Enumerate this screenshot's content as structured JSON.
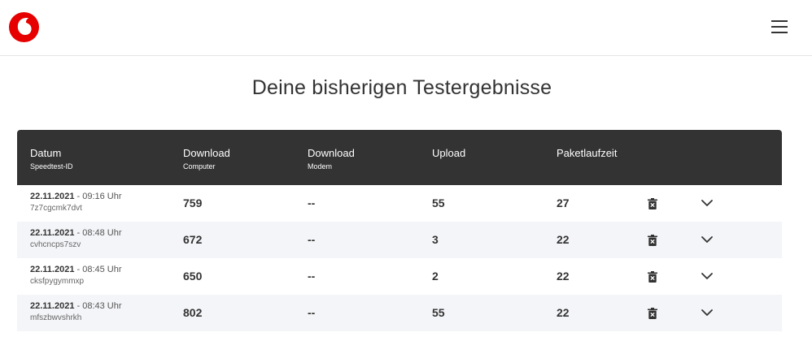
{
  "header": {
    "logo_icon": "vodafone-logo-icon",
    "menu_icon": "hamburger-menu-icon"
  },
  "page": {
    "title": "Deine bisherigen Testergebnisse"
  },
  "table": {
    "columns": [
      {
        "main": "Datum",
        "sub": "Speedtest-ID"
      },
      {
        "main": "Download",
        "sub": "Computer"
      },
      {
        "main": "Download",
        "sub": "Modem"
      },
      {
        "main": "Upload",
        "sub": ""
      },
      {
        "main": "Paketlaufzeit",
        "sub": ""
      }
    ],
    "rows": [
      {
        "date": "22.11.2021",
        "time": " - 09:16 Uhr",
        "id": "7z7cgcmk7dvt",
        "download_computer": "759",
        "download_modem": "--",
        "upload": "55",
        "ping": "27"
      },
      {
        "date": "22.11.2021",
        "time": " - 08:48 Uhr",
        "id": "cvhcncps7szv",
        "download_computer": "672",
        "download_modem": "--",
        "upload": "3",
        "ping": "22"
      },
      {
        "date": "22.11.2021",
        "time": " - 08:45 Uhr",
        "id": "cksfpygymmxp",
        "download_computer": "650",
        "download_modem": "--",
        "upload": "2",
        "ping": "22"
      },
      {
        "date": "22.11.2021",
        "time": " - 08:43 Uhr",
        "id": "mfszbwvshrkh",
        "download_computer": "802",
        "download_modem": "--",
        "upload": "55",
        "ping": "22"
      }
    ],
    "row_actions": {
      "delete_icon": "trash-icon",
      "expand_icon": "chevron-down-icon"
    }
  },
  "colors": {
    "brand_red": "#e60000",
    "header_bg": "#333333",
    "row_alt_bg": "#f4f5f8"
  }
}
